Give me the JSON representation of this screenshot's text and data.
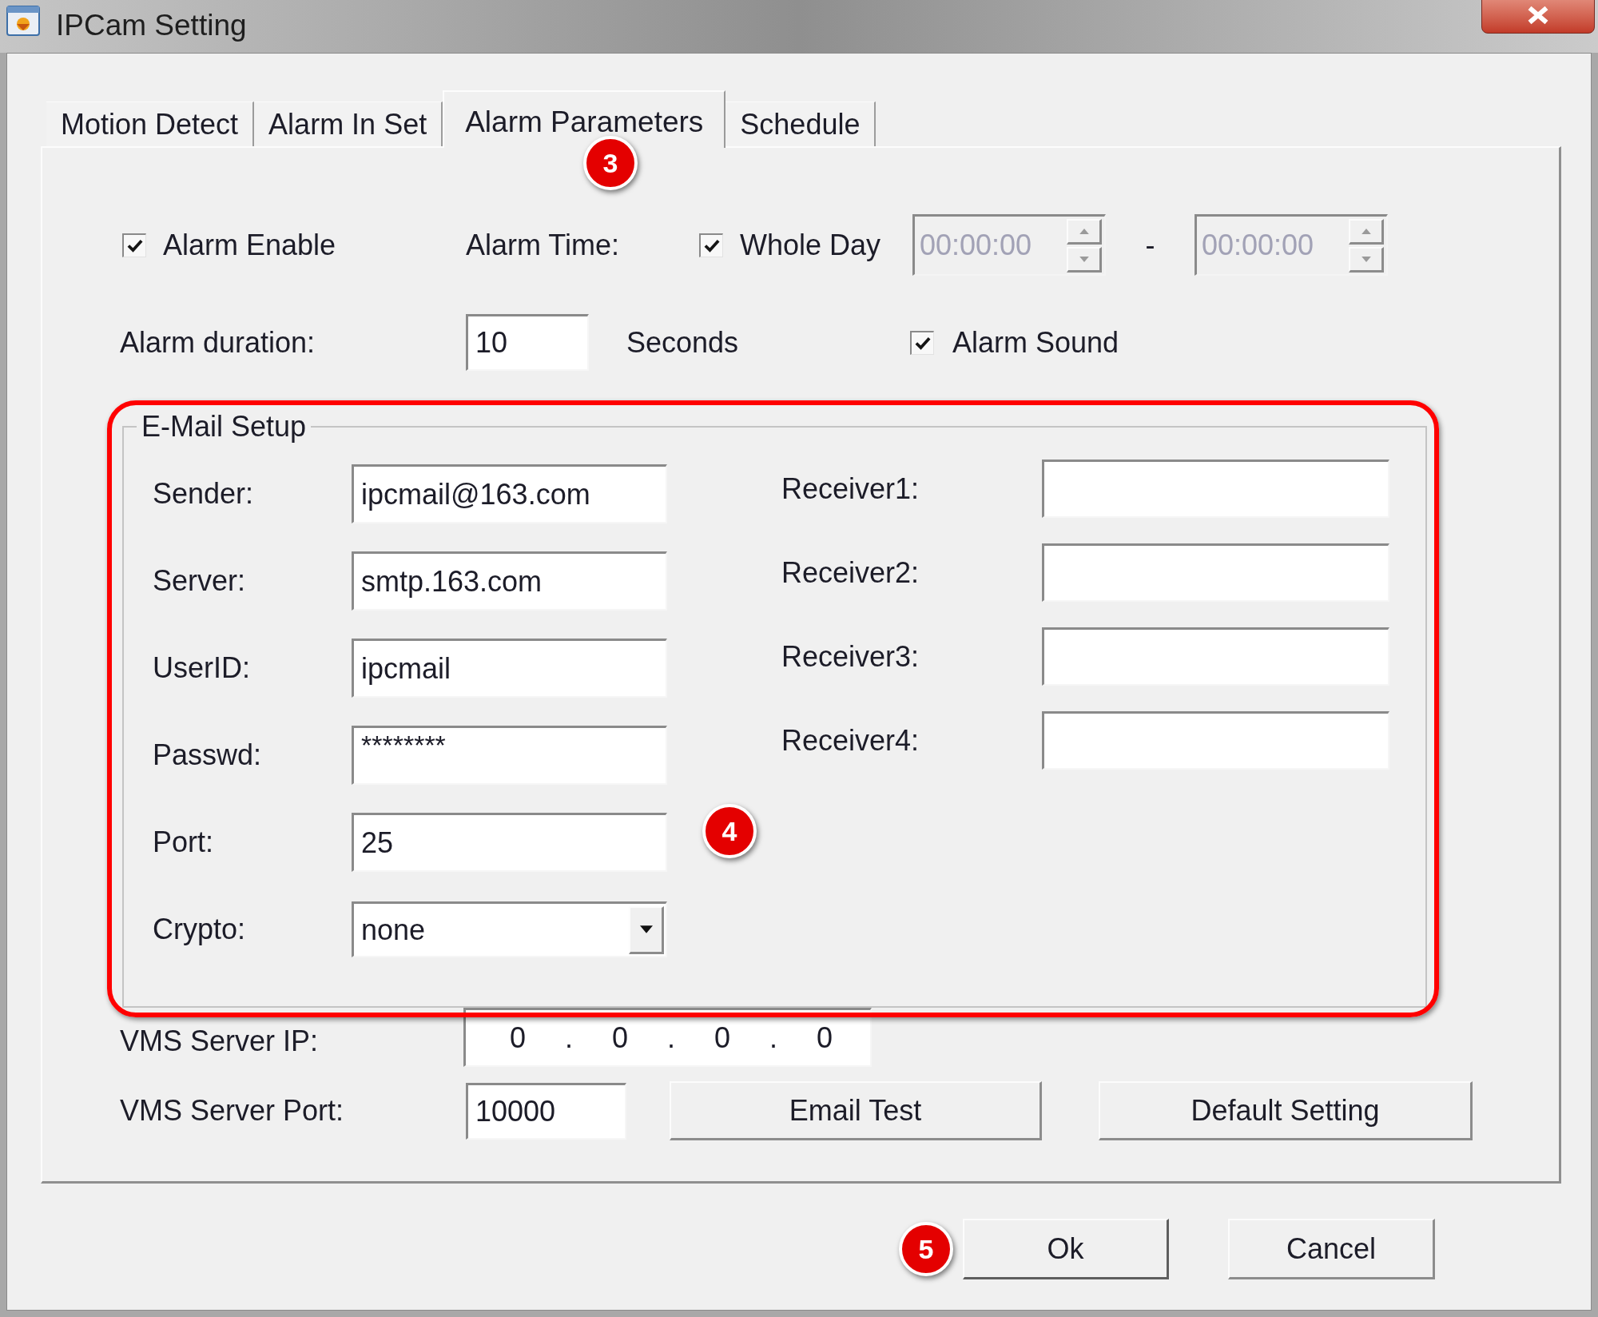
{
  "window": {
    "title": "IPCam Setting"
  },
  "tabs": [
    {
      "label": "Motion Detect",
      "selected": false
    },
    {
      "label": "Alarm In Set",
      "selected": false
    },
    {
      "label": "Alarm Parameters",
      "selected": true
    },
    {
      "label": "Schedule",
      "selected": false
    }
  ],
  "alarm_enable": {
    "label": "Alarm Enable",
    "checked": true
  },
  "alarm_time": {
    "label": "Alarm Time:",
    "whole_day": {
      "label": "Whole Day",
      "checked": true
    },
    "start": {
      "value": "00:00:00",
      "disabled": true
    },
    "separator": "-",
    "end": {
      "value": "00:00:00",
      "disabled": true
    }
  },
  "alarm_duration": {
    "label": "Alarm duration:",
    "value": "10",
    "unit": "Seconds"
  },
  "alarm_sound": {
    "label": "Alarm Sound",
    "checked": true
  },
  "email_setup": {
    "title": "E-Mail Setup",
    "highlighted": true,
    "fields": [
      {
        "label": "Sender:",
        "value": "ipcmail@163.com",
        "kind": "text"
      },
      {
        "label": "Server:",
        "value": "smtp.163.com",
        "kind": "text"
      },
      {
        "label": "UserID:",
        "value": "ipcmail",
        "kind": "text"
      },
      {
        "label": "Passwd:",
        "value": "********",
        "kind": "password"
      },
      {
        "label": "Port:",
        "value": "25",
        "kind": "text"
      },
      {
        "label": "Crypto:",
        "value": "none",
        "kind": "select"
      }
    ],
    "receivers": [
      {
        "label": "Receiver1:"
      },
      {
        "label": "Receiver2:"
      },
      {
        "label": "Receiver3:"
      },
      {
        "label": "Receiver4:"
      }
    ]
  },
  "vms_server_ip": {
    "label": "VMS Server IP:",
    "parts": [
      "0",
      ".",
      "0",
      ".",
      "0",
      ".",
      "0"
    ]
  },
  "vms_server_port": {
    "label": "VMS Server Port:",
    "value": "10000"
  },
  "panel_buttons": [
    "Email Test",
    "Default Setting"
  ],
  "dialog_buttons": [
    "Ok",
    "Cancel"
  ],
  "callouts": [
    "3",
    "4",
    "5"
  ]
}
